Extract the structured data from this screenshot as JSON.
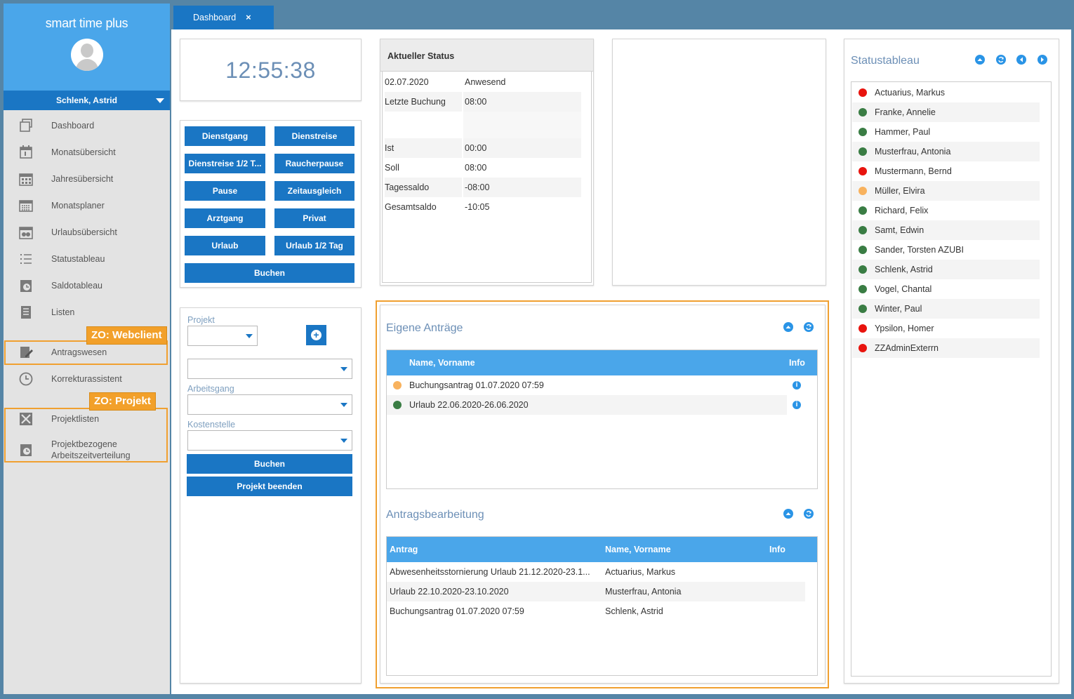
{
  "app": {
    "title": "smart time plus",
    "user": "Schlenk, Astrid"
  },
  "nav": [
    {
      "label": "Dashboard",
      "icon": "dashboard-icon"
    },
    {
      "label": "Monatsübersicht",
      "icon": "calendar-month-icon"
    },
    {
      "label": "Jahresübersicht",
      "icon": "calendar-year-icon"
    },
    {
      "label": "Monatsplaner",
      "icon": "planner-icon"
    },
    {
      "label": "Urlaubsübersicht",
      "icon": "vacation-icon"
    },
    {
      "label": "Statustableau",
      "icon": "list-icon"
    },
    {
      "label": "Saldotableau",
      "icon": "clock-calendar-icon"
    },
    {
      "label": "Listen",
      "icon": "document-list-icon"
    },
    {
      "label": "Antragswesen",
      "icon": "edit-document-icon"
    },
    {
      "label": "Korrekturassistent",
      "icon": "clock-icon"
    },
    {
      "label": "Projektlisten",
      "icon": "tools-icon"
    },
    {
      "label": "Projektbezogene Arbeitszeitverteilung",
      "icon": "clock-calendar-icon"
    }
  ],
  "callouts": {
    "webclient": "ZO: Webclient",
    "projekt": "ZO: Projekt"
  },
  "tabs": [
    {
      "label": "Dashboard",
      "close": "×"
    }
  ],
  "clock": {
    "time": "12:55:38"
  },
  "booking_buttons": [
    "Dienstgang",
    "Dienstreise",
    "Dienstreise 1/2 T...",
    "Raucherpause",
    "Pause",
    "Zeitausgleich",
    "Arztgang",
    "Privat",
    "Urlaub",
    "Urlaub 1/2 Tag"
  ],
  "booking": {
    "submit": "Buchen"
  },
  "project": {
    "projekt_label": "Projekt",
    "arbeitsgang_label": "Arbeitsgang",
    "kostenstelle_label": "Kostenstelle",
    "book": "Buchen",
    "finish": "Projekt beenden"
  },
  "status": {
    "title": "Aktueller Status",
    "rows": [
      {
        "k": "02.07.2020",
        "v": "Anwesend"
      },
      {
        "k": "Letzte Buchung",
        "v": "08:00"
      },
      {
        "k": "",
        "v": ""
      },
      {
        "k": "Ist",
        "v": "00:00"
      },
      {
        "k": "Soll",
        "v": "08:00"
      },
      {
        "k": "Tagessaldo",
        "v": "-08:00"
      },
      {
        "k": "Gesamtsaldo",
        "v": "-10:05"
      }
    ]
  },
  "eigene_antraege": {
    "title": "Eigene Anträge",
    "col_name": "Name, Vorname",
    "col_info": "Info",
    "rows": [
      {
        "text": "Buchungsantrag 01.07.2020 07:59",
        "status_color": "#f8b25e"
      },
      {
        "text": "Urlaub 22.06.2020-26.06.2020",
        "status_color": "#3a7d44"
      }
    ]
  },
  "antragsbearbeitung": {
    "title": "Antragsbearbeitung",
    "col_antrag": "Antrag",
    "col_name": "Name, Vorname",
    "col_info": "Info",
    "rows": [
      {
        "antrag": "Abwesenheitsstornierung Urlaub 21.12.2020-23.1...",
        "name": "Actuarius, Markus"
      },
      {
        "antrag": "Urlaub 22.10.2020-23.10.2020",
        "name": "Musterfrau, Antonia"
      },
      {
        "antrag": "Buchungsantrag 01.07.2020 07:59",
        "name": "Schlenk, Astrid"
      }
    ]
  },
  "statustableau": {
    "title": "Statustableau",
    "people": [
      {
        "name": "Actuarius, Markus",
        "color": "#e8140e"
      },
      {
        "name": "Franke, Annelie",
        "color": "#3a7d44"
      },
      {
        "name": "Hammer, Paul",
        "color": "#3a7d44"
      },
      {
        "name": "Musterfrau, Antonia",
        "color": "#3a7d44"
      },
      {
        "name": "Mustermann, Bernd",
        "color": "#e8140e"
      },
      {
        "name": "Müller, Elvira",
        "color": "#f8b25e"
      },
      {
        "name": "Richard, Felix",
        "color": "#3a7d44"
      },
      {
        "name": "Samt, Edwin",
        "color": "#3a7d44"
      },
      {
        "name": "Sander, Torsten AZUBI",
        "color": "#3a7d44"
      },
      {
        "name": "Schlenk, Astrid",
        "color": "#3a7d44"
      },
      {
        "name": "Vogel, Chantal",
        "color": "#3a7d44"
      },
      {
        "name": "Winter, Paul",
        "color": "#3a7d44"
      },
      {
        "name": "Ypsilon, Homer",
        "color": "#e8140e"
      },
      {
        "name": "ZZAdminExterrn",
        "color": "#e8140e"
      }
    ]
  },
  "colors": {
    "primary": "#1a76c4",
    "header_blue": "#4aa6ea",
    "accent_orange": "#f0a030",
    "frame": "#5585a6"
  }
}
